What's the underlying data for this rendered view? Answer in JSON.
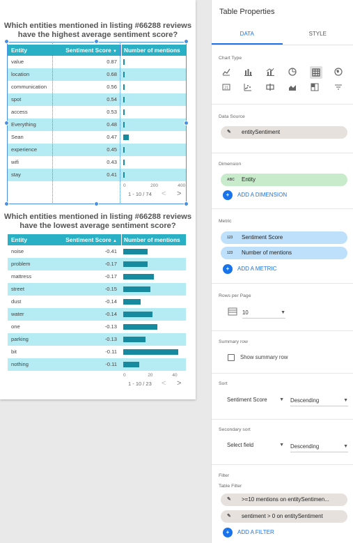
{
  "canvas": {
    "chart1": {
      "title_line1": "Which entities mentioned in listing #66288 reviews",
      "title_line2": "have the highest average sentiment score?",
      "headers": {
        "entity": "Entity",
        "score": "Sentiment Score",
        "score_sort": "▼",
        "mentions": "Number of mentions"
      },
      "rows": [
        {
          "entity": "value",
          "score": "0.87",
          "mentions": 1
        },
        {
          "entity": "location",
          "score": "0.68",
          "mentions": 11
        },
        {
          "entity": "communication",
          "score": "0.56",
          "mentions": 1
        },
        {
          "entity": "spot",
          "score": "0.54",
          "mentions": 1
        },
        {
          "entity": "access",
          "score": "0.53",
          "mentions": 2
        },
        {
          "entity": "Everything",
          "score": "0.48",
          "mentions": 1
        },
        {
          "entity": "Sean",
          "score": "0.47",
          "mentions": 41
        },
        {
          "entity": "experience",
          "score": "0.45",
          "mentions": 3
        },
        {
          "entity": "wifi",
          "score": "0.43",
          "mentions": 1
        },
        {
          "entity": "stay",
          "score": "0.41",
          "mentions": 9
        }
      ],
      "axis_max": 450,
      "axis_ticks": [
        "0",
        "200",
        "400"
      ],
      "pager": "1 - 10 / 74"
    },
    "chart2": {
      "title_line1": "Which entities mentioned in listing #66288 reviews",
      "title_line2": "have the lowest average sentiment score?",
      "headers": {
        "entity": "Entity",
        "score": "Sentiment Score",
        "score_sort": "▲",
        "mentions": "Number of mentions"
      },
      "rows": [
        {
          "entity": "noise",
          "score": "-0.41",
          "mentions": 20
        },
        {
          "entity": "problem",
          "score": "-0.17",
          "mentions": 20
        },
        {
          "entity": "mattress",
          "score": "-0.17",
          "mentions": 25
        },
        {
          "entity": "street",
          "score": "-0.15",
          "mentions": 22
        },
        {
          "entity": "dust",
          "score": "-0.14",
          "mentions": 14
        },
        {
          "entity": "water",
          "score": "-0.14",
          "mentions": 24
        },
        {
          "entity": "one",
          "score": "-0.13",
          "mentions": 28
        },
        {
          "entity": "parking",
          "score": "-0.13",
          "mentions": 18
        },
        {
          "entity": "bit",
          "score": "-0.11",
          "mentions": 45
        },
        {
          "entity": "nothing",
          "score": "-0.11",
          "mentions": 13
        }
      ],
      "axis_max": 50,
      "axis_ticks": [
        "0",
        "20",
        "40"
      ],
      "pager": "1 - 10 / 23"
    },
    "pager_prev": "<",
    "pager_next": ">"
  },
  "panel": {
    "title": "Table Properties",
    "tabs": [
      "DATA",
      "STYLE"
    ],
    "chart_type_label": "Chart Type",
    "chart_type_icons": [
      "line-chart-icon",
      "bar-chart-icon",
      "combo-chart-icon",
      "pie-chart-icon",
      "table-icon",
      "geo-map-icon",
      "scorecard-icon",
      "scatter-chart-icon",
      "pivot-table-icon",
      "area-chart-icon",
      "treemap-icon",
      "filter-control-icon"
    ],
    "data_source_label": "Data Source",
    "data_source": "entitySentiment",
    "dimension_label": "Dimension",
    "dimension": "Entity",
    "dimension_type": "ABC",
    "add_dimension": "ADD A DIMENSION",
    "metric_label": "Metric",
    "metrics": [
      "Sentiment Score",
      "Number of mentions"
    ],
    "metric_type": "123",
    "add_metric": "ADD A METRIC",
    "rows_per_page_label": "Rows per Page",
    "rows_per_page": "10",
    "summary_row_label": "Summary row",
    "show_summary_row": "Show summary row",
    "sort_label": "Sort",
    "sort_field": "Sentiment Score",
    "sort_order": "Descending",
    "secondary_sort_label": "Secondary sort",
    "secondary_field": "Select field",
    "secondary_order": "Descending",
    "filter_label": "Filter",
    "table_filter_label": "Table Filter",
    "filters": [
      ">=10 mentions on entitySentimen...",
      "sentiment > 0 on entitySentiment"
    ],
    "add_filter": "ADD A FILTER"
  },
  "colors": {
    "header": "#2ab0c4",
    "stripe": "#b5ebf2",
    "bar": "#178aa0",
    "accent": "#1a73e8"
  }
}
